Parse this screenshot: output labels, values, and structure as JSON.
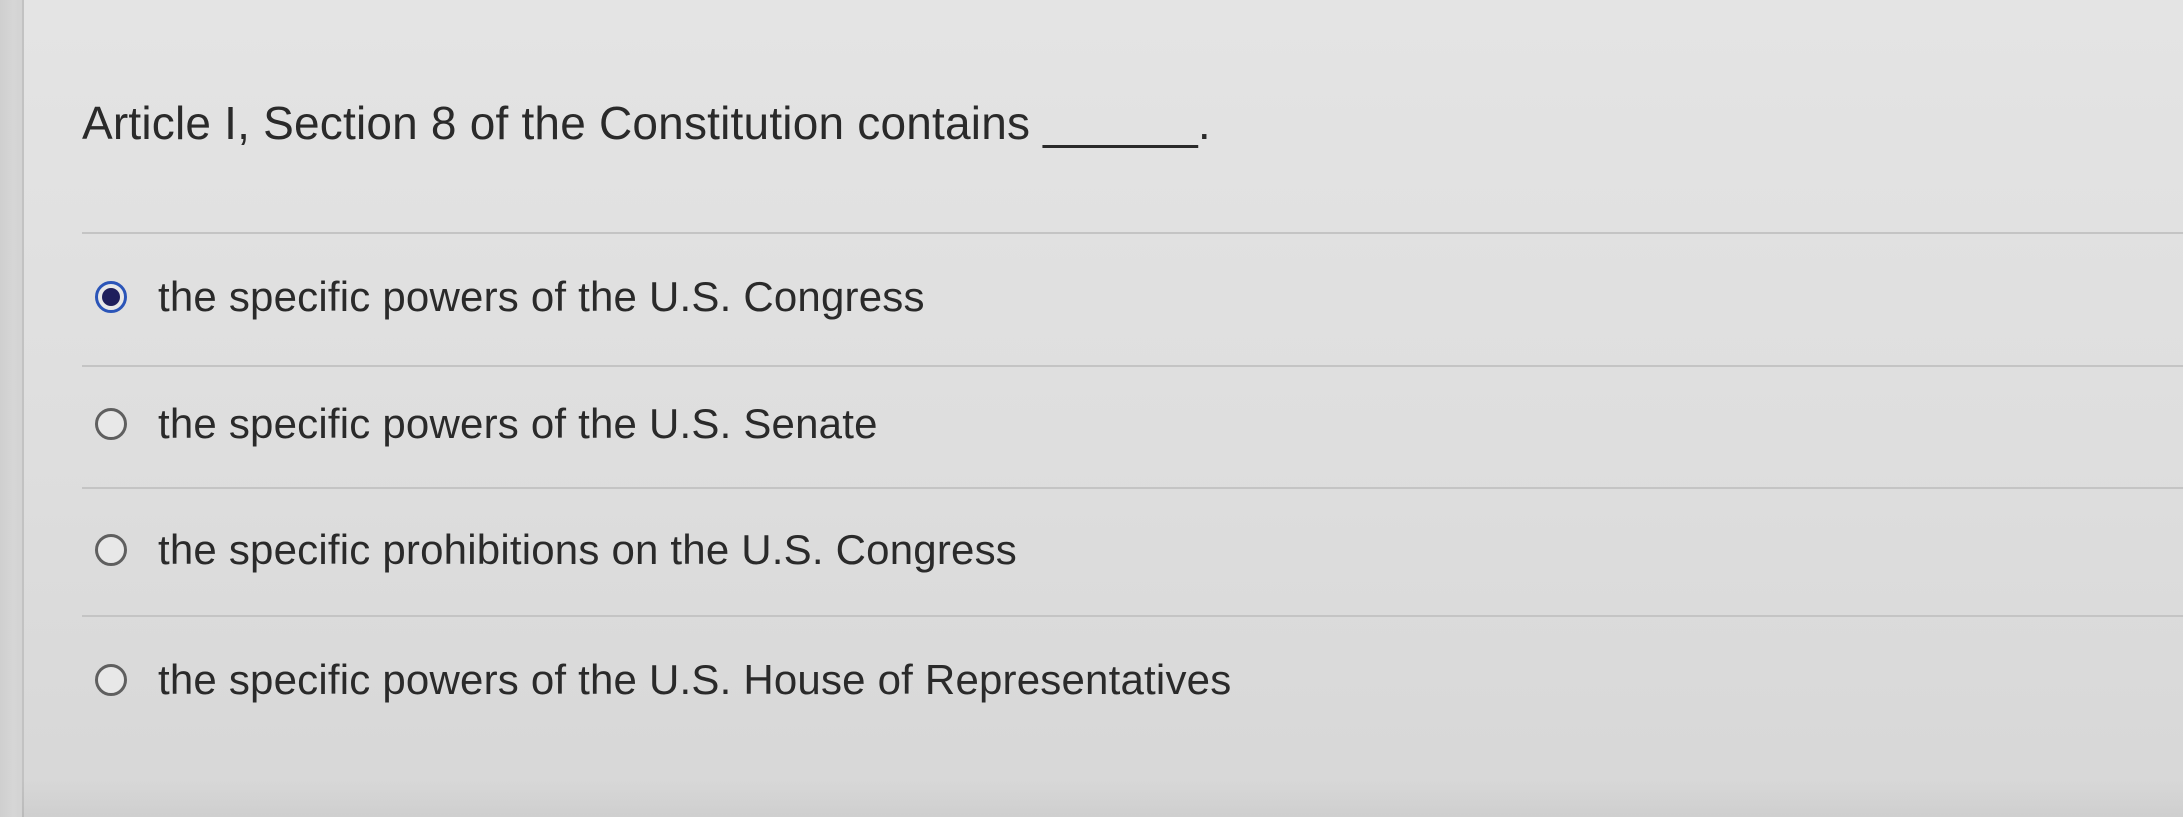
{
  "question": {
    "text": "Article I, Section 8 of the Constitution contains ______."
  },
  "options": [
    {
      "label": "the specific powers of the U.S. Congress",
      "selected": true
    },
    {
      "label": "the specific powers of the U.S. Senate",
      "selected": false
    },
    {
      "label": "the specific prohibitions on the U.S. Congress",
      "selected": false
    },
    {
      "label": "the specific powers of the U.S. House of Representatives",
      "selected": false
    }
  ],
  "colors": {
    "background": "#e0e0e0",
    "text": "#2a2a2a",
    "selected_radio_ring": "#2b55b8",
    "selected_radio_dot": "#1f1f5c",
    "radio_ring": "#5f5f5f",
    "divider": "#c4c4c4"
  }
}
